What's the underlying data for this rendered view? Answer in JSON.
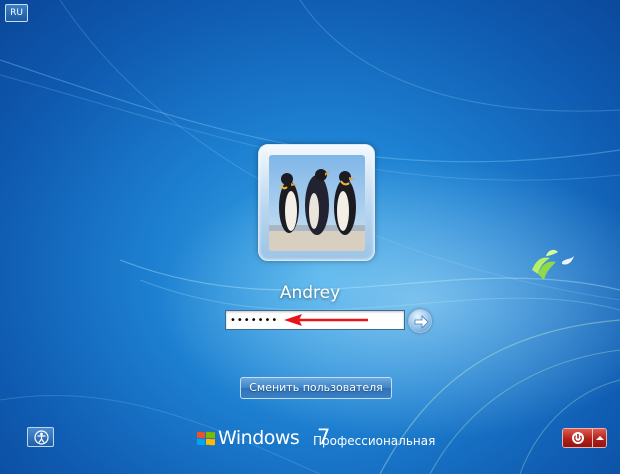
{
  "language_indicator": "RU",
  "user": {
    "name": "Andrey",
    "avatar_icon": "penguins-photo"
  },
  "password": {
    "value": "•••••••",
    "annotation_arrow_color": "#e8141c"
  },
  "submit": {
    "icon": "arrow-right-icon"
  },
  "switch_user_label": "Сменить пользователя",
  "brand": {
    "name": "Windows",
    "version": "7",
    "edition": "Профессиональная"
  },
  "ease_of_access": {
    "icon": "ease-of-access-icon"
  },
  "power": {
    "icon": "power-icon",
    "options_icon": "chevron-up-icon"
  },
  "colors": {
    "background": "#1d7fd0",
    "power_red": "#b3211a",
    "field_border": "#3f6a96"
  }
}
